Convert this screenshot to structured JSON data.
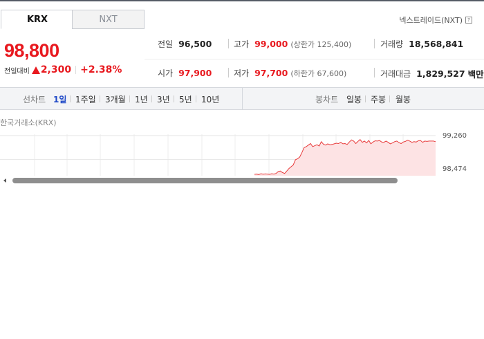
{
  "tabs": [
    {
      "label": "KRX",
      "active": true
    },
    {
      "label": "NXT",
      "active": false
    }
  ],
  "nxt_link": "넥스트레이드(NXT)",
  "price": {
    "current": "98,800",
    "change_label": "전일대비",
    "change_amount": "2,300",
    "change_rate": "+2.38%",
    "direction": "up"
  },
  "stats": {
    "prev_close": {
      "label": "전일",
      "value": "96,500"
    },
    "high": {
      "label": "고가",
      "value": "99,000",
      "limit_text": "(상한가 125,400)"
    },
    "volume": {
      "label": "거래량",
      "value": "18,568,841"
    },
    "open": {
      "label": "시가",
      "value": "97,900"
    },
    "low": {
      "label": "저가",
      "value": "97,700",
      "limit_text": "(하한가 67,600)"
    },
    "amount": {
      "label": "거래대금",
      "value": "1,829,527",
      "unit": "백만"
    }
  },
  "line_chart_periods": {
    "label": "선차트",
    "items": [
      "1일",
      "1주일",
      "3개월",
      "1년",
      "3년",
      "5년",
      "10년"
    ],
    "active": "1일"
  },
  "candle_chart_periods": {
    "label": "봉차트",
    "items": [
      "일봉",
      "주봉",
      "월봉"
    ]
  },
  "chart": {
    "title": "한국거래소(KRX)",
    "y_ticks": [
      "99,260",
      "98,474"
    ]
  },
  "colors": {
    "up": "#e8191f",
    "accent_blue": "#1f49c7",
    "chart_line": "#e83a3a",
    "chart_fill": "#fde3e4"
  },
  "chart_data": {
    "type": "area",
    "title": "",
    "ylim": [
      97900,
      99260
    ],
    "y_ticks": [
      99260,
      98474
    ],
    "y_values": [
      97990,
      98000,
      97985,
      98010,
      97995,
      98005,
      98000,
      97990,
      98010,
      98000,
      98020,
      98080,
      98100,
      98050,
      98020,
      98100,
      98180,
      98240,
      98300,
      98470,
      98500,
      98560,
      98700,
      98860,
      98900,
      98950,
      99000,
      98900,
      98930,
      98960,
      98920,
      99060,
      98980,
      98950,
      98990,
      98960,
      98970,
      98990,
      99010,
      99000,
      99040,
      98990,
      99000,
      98970,
      99050,
      99120,
      99080,
      99000,
      99070,
      99130,
      99040,
      99080,
      99020,
      99100,
      98990,
      99050,
      99090,
      99080,
      99100,
      99050,
      99040,
      99080,
      99040,
      98990,
      99020,
      99060,
      99080,
      99030,
      99000,
      99050,
      99070,
      99110,
      99080,
      99040,
      99060,
      99050,
      99090,
      99100,
      99040,
      99080,
      99070,
      99080,
      99080,
      99080,
      99060
    ]
  },
  "scrollbar": {
    "position": 0.8
  }
}
